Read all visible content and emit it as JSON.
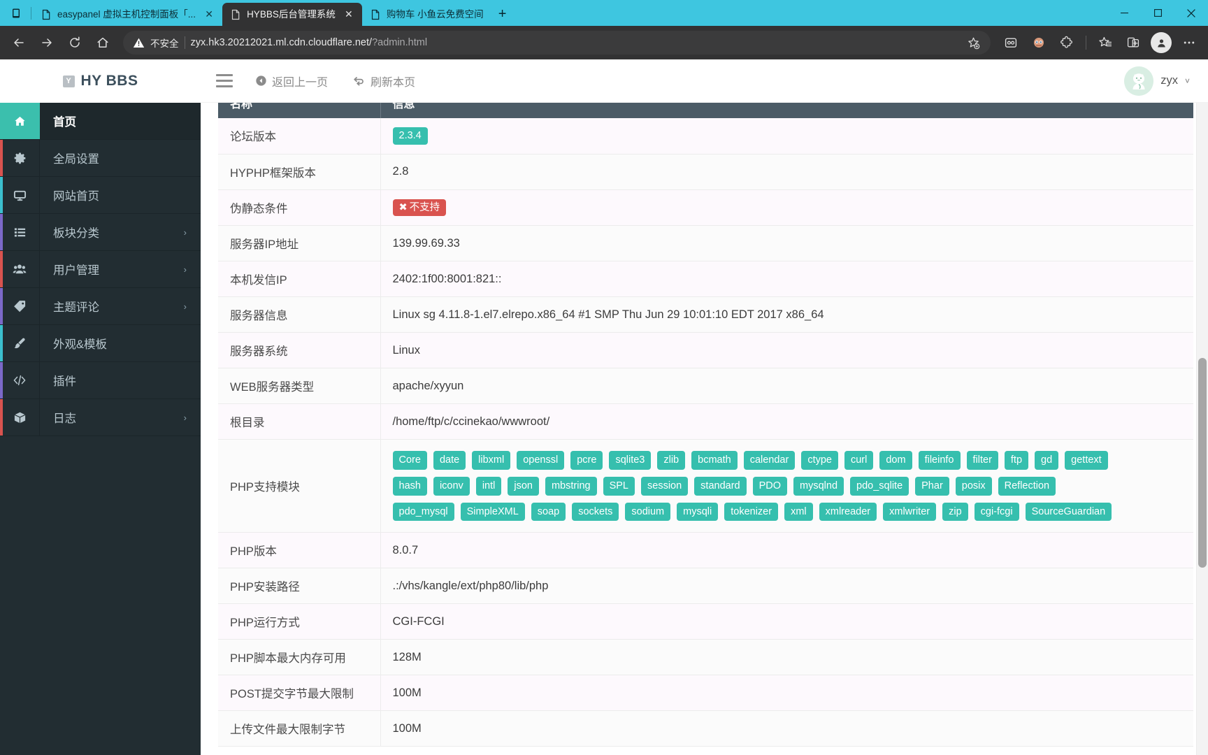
{
  "browser": {
    "tabs": [
      {
        "title": "easypanel 虚拟主机控制面板「...",
        "active": false,
        "close_label": "✕"
      },
      {
        "title": "HYBBS后台管理系统",
        "active": true,
        "close_label": "✕"
      },
      {
        "title": "购物车  小鱼云免费空间",
        "active": false,
        "close_label": ""
      }
    ],
    "new_tab_label": "+",
    "window_controls": {
      "minimize": "—",
      "maximize": "❐",
      "close": "✕"
    },
    "nav": {
      "back": "←",
      "forward": "→",
      "reload": "↻",
      "home": "⌂"
    },
    "security_label": "不安全",
    "url_text": "zyx.hk3.20212021.ml.cdn.cloudflare.net/",
    "url_suffix": "?admin.html",
    "toolbar_icons": [
      "add-favorite-icon",
      "collections-icon",
      "extension-color-icon",
      "extensions-puzzle-icon",
      "favorites-icon",
      "split-screen-icon",
      "profile-icon",
      "settings-more-icon"
    ]
  },
  "sidebar": {
    "brand_mark": "Y",
    "brand_text": "HY BBS",
    "items": [
      {
        "label": "首页",
        "icon": "home-icon",
        "accent": "#3bbfad",
        "chevron": "",
        "active": true
      },
      {
        "label": "全局设置",
        "icon": "gear-icon",
        "accent": "#d9534f",
        "chevron": "",
        "active": false
      },
      {
        "label": "网站首页",
        "icon": "monitor-icon",
        "accent": "#3bbfce",
        "chevron": "",
        "active": false
      },
      {
        "label": "板块分类",
        "icon": "list-icon",
        "accent": "#7b68c8",
        "chevron": "›",
        "active": false
      },
      {
        "label": "用户管理",
        "icon": "users-icon",
        "accent": "#d9534f",
        "chevron": "›",
        "active": false
      },
      {
        "label": "主题评论",
        "icon": "tag-icon",
        "accent": "#7b68c8",
        "chevron": "›",
        "active": false
      },
      {
        "label": "外观&模板",
        "icon": "brush-icon",
        "accent": "#3bbfce",
        "chevron": "",
        "active": false
      },
      {
        "label": "插件",
        "icon": "code-icon",
        "accent": "#7b68c8",
        "chevron": "",
        "active": false
      },
      {
        "label": "日志",
        "icon": "box-icon",
        "accent": "#d9534f",
        "chevron": "›",
        "active": false
      }
    ]
  },
  "topbar": {
    "menu_toggle": "hamburger-icon",
    "back_label": "返回上一页",
    "refresh_label": "刷新本页",
    "username": "zyx",
    "caret": "˅"
  },
  "table": {
    "headers": [
      "名称",
      "信息"
    ],
    "rows": [
      {
        "key": "论坛版本",
        "type": "badge",
        "value": "2.3.4"
      },
      {
        "key": "HYPHP框架版本",
        "type": "text",
        "value": "2.8"
      },
      {
        "key": "伪静态条件",
        "type": "danger",
        "value": "不支持",
        "x": "✖"
      },
      {
        "key": "服务器IP地址",
        "type": "text",
        "value": "139.99.69.33"
      },
      {
        "key": "本机发信IP",
        "type": "text",
        "value": "2402:1f00:8001:821::"
      },
      {
        "key": "服务器信息",
        "type": "text",
        "value": "Linux sg 4.11.8-1.el7.elrepo.x86_64 #1 SMP Thu Jun 29 10:01:10 EDT 2017 x86_64"
      },
      {
        "key": "服务器系统",
        "type": "text",
        "value": "Linux"
      },
      {
        "key": "WEB服务器类型",
        "type": "text",
        "value": "apache/xyyun"
      },
      {
        "key": "根目录",
        "type": "text",
        "value": "/home/ftp/c/ccinekao/wwwroot/"
      },
      {
        "key": "PHP支持模块",
        "type": "badges",
        "value": [
          "Core",
          "date",
          "libxml",
          "openssl",
          "pcre",
          "sqlite3",
          "zlib",
          "bcmath",
          "calendar",
          "ctype",
          "curl",
          "dom",
          "fileinfo",
          "filter",
          "ftp",
          "gd",
          "gettext",
          "hash",
          "iconv",
          "intl",
          "json",
          "mbstring",
          "SPL",
          "session",
          "standard",
          "PDO",
          "mysqlnd",
          "pdo_sqlite",
          "Phar",
          "posix",
          "Reflection",
          "pdo_mysql",
          "SimpleXML",
          "soap",
          "sockets",
          "sodium",
          "mysqli",
          "tokenizer",
          "xml",
          "xmlreader",
          "xmlwriter",
          "zip",
          "cgi-fcgi",
          "SourceGuardian"
        ]
      },
      {
        "key": "PHP版本",
        "type": "text",
        "value": "8.0.7"
      },
      {
        "key": "PHP安装路径",
        "type": "text",
        "value": ".:/vhs/kangle/ext/php80/lib/php"
      },
      {
        "key": "PHP运行方式",
        "type": "text",
        "value": "CGI-FCGI"
      },
      {
        "key": "PHP脚本最大内存可用",
        "type": "text",
        "value": "128M"
      },
      {
        "key": "POST提交字节最大限制",
        "type": "text",
        "value": "100M"
      },
      {
        "key": "上传文件最大限制字节",
        "type": "text",
        "value": "100M"
      }
    ]
  },
  "colors": {
    "accent_teal": "#36bfae",
    "danger_red": "#d9534f",
    "sidebar_bg": "#222d32",
    "table_header": "#4b5b66",
    "tabstrip": "#3ec6e0"
  }
}
